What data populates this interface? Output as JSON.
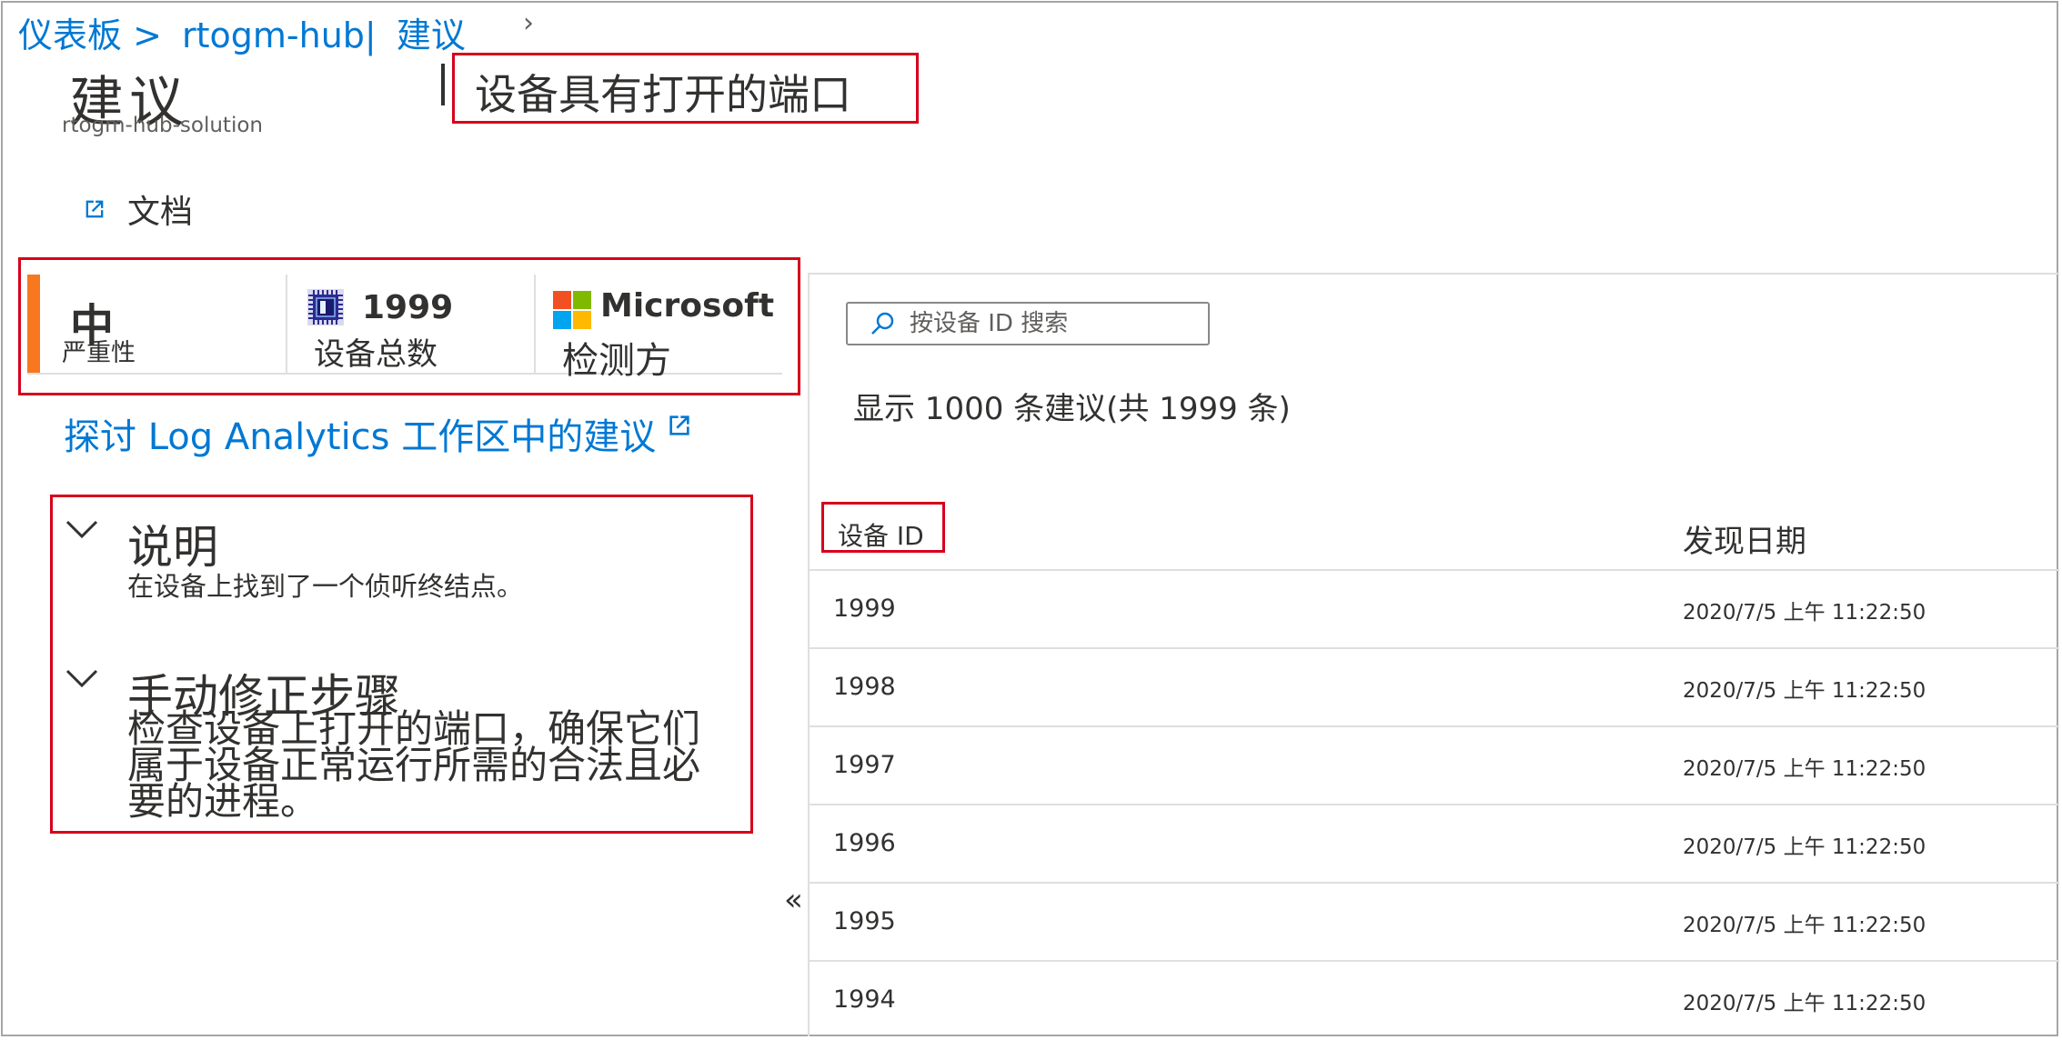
{
  "breadcrumb": {
    "items": [
      "仪表板 >",
      "rtogm-hub|",
      "建议"
    ]
  },
  "blade": {
    "title": "建议",
    "subtitle": "rtogm-hub-solution"
  },
  "recommendation": {
    "title": "设备具有打开的端口"
  },
  "toolbar": {
    "docs_label": "文档"
  },
  "summary": {
    "severity_value": "中",
    "severity_label": "严重性",
    "severity_color": "#f7781f",
    "device_count": "1999",
    "device_count_label": "设备总数",
    "detector_name": "Microsoft",
    "detector_label": "检测方"
  },
  "links": {
    "log_analytics": "探讨 Log Analytics 工作区中的建议"
  },
  "details": {
    "description_heading": "说明",
    "description_text": "在设备上找到了一个侦听终结点。",
    "remediation_heading": "手动修正步骤",
    "remediation_text": "检查设备上打开的端口，确保它们属于设备正常运行所需的合法且必要的进程。"
  },
  "panel": {
    "collapse_glyph": "«"
  },
  "search": {
    "placeholder": "按设备 ID 搜索"
  },
  "results": {
    "summary": "显示 1000 条建议(共 1999 条)"
  },
  "table": {
    "columns": [
      "设备 ID",
      "发现日期"
    ],
    "rows": [
      {
        "id": "1999",
        "date": "2020/7/5 上午 11:22:50"
      },
      {
        "id": "1998",
        "date": "2020/7/5 上午 11:22:50"
      },
      {
        "id": "1997",
        "date": "2020/7/5 上午 11:22:50"
      },
      {
        "id": "1996",
        "date": "2020/7/5 上午 11:22:50"
      },
      {
        "id": "1995",
        "date": "2020/7/5 上午 11:22:50"
      },
      {
        "id": "1994",
        "date": "2020/7/5 上午 11:22:50"
      }
    ]
  },
  "icons": {
    "external_link": "external-link-icon",
    "device_chip": "chip-icon",
    "microsoft_logo": "microsoft-logo-icon",
    "search": "search-icon",
    "chevron": "chevron-down-icon"
  },
  "colors": {
    "accent": "#0078d4",
    "highlight_border": "#d6001c",
    "severity_medium": "#f7781f"
  }
}
